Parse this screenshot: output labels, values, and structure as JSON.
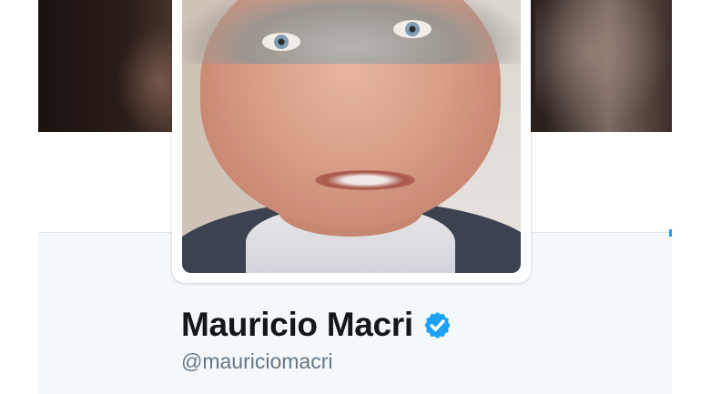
{
  "profile": {
    "display_name": "Mauricio Macri",
    "handle": "@mauriciomacri",
    "verified": true
  },
  "icons": {
    "verified": "verified-badge-icon"
  },
  "colors": {
    "verified_badge": "#1da1f2",
    "name_text": "#14171a",
    "handle_text": "#657786",
    "card_background": "#f5f8fa"
  }
}
